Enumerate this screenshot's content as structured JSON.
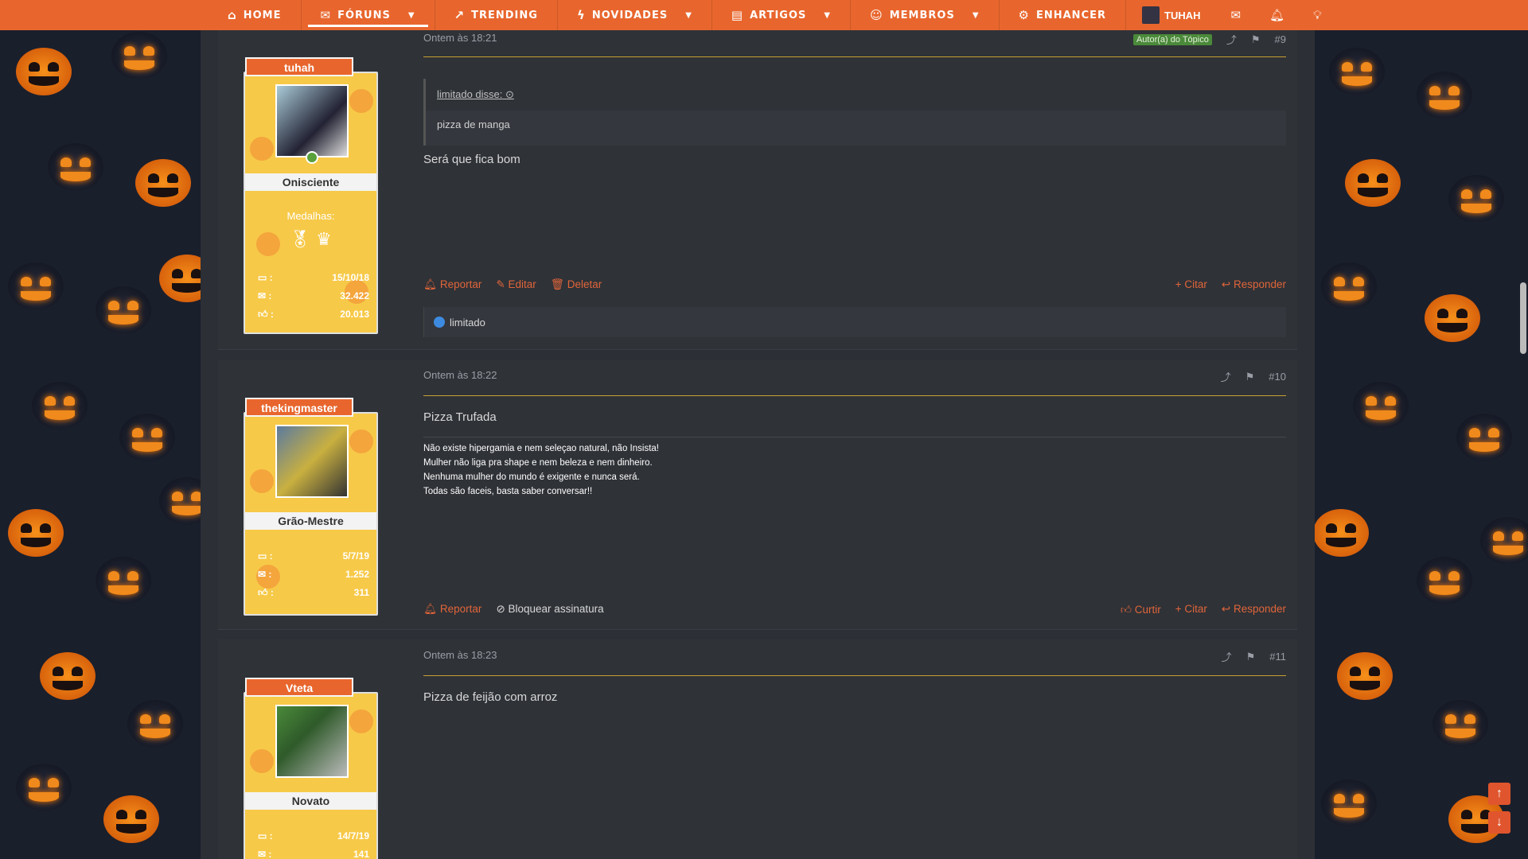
{
  "nav": {
    "items": [
      {
        "label": "HOME",
        "icon": "home-icon",
        "glyph": "⌂"
      },
      {
        "label": "FÓRUNS",
        "icon": "chat-icon",
        "glyph": "💬",
        "caret": true,
        "active": true
      },
      {
        "label": "TRENDING",
        "icon": "trending-icon",
        "glyph": "📈"
      },
      {
        "label": "NOVIDADES",
        "icon": "bolt-icon",
        "glyph": "⚡",
        "caret": true
      },
      {
        "label": "ARTIGOS",
        "icon": "document-icon",
        "glyph": "▤",
        "caret": true
      },
      {
        "label": "MEMBROS",
        "icon": "users-icon",
        "glyph": "👥",
        "caret": true
      },
      {
        "label": "ENHANCER",
        "icon": "cogs-icon",
        "glyph": "⚙"
      }
    ],
    "user": "TUHAH"
  },
  "posts": [
    {
      "username": "tuhah",
      "rank": "Onisciente",
      "medals_label": "Medalhas:",
      "date": "Ontem às 18:21",
      "badge": "Autor(a) do Tópico",
      "number": "#9",
      "quote_author": "limitado disse:",
      "quote_text": "pizza de manga",
      "message": "Será que fica bom",
      "stats": [
        "15/10/18",
        "32.422",
        "20.013"
      ],
      "actions_left": [
        "Reportar",
        "Editar",
        "Deletar"
      ],
      "actions_right": [
        "Citar",
        "Responder"
      ],
      "reaction_user": "limitado"
    },
    {
      "username": "thekingmaster",
      "rank": "Grão-Mestre",
      "date": "Ontem às 18:22",
      "number": "#10",
      "message": "Pizza Trufada",
      "signature": [
        "Não existe hipergamia e nem seleçao natural, não Insista!",
        "Mulher não liga pra shape e nem beleza e nem dinheiro.",
        "Nenhuma mulher do mundo é exigente e nunca será.",
        "Todas são faceis, basta saber conversar!!"
      ],
      "stats": [
        "5/7/19",
        "1.252",
        "311"
      ],
      "actions_left": [
        "Reportar",
        "Bloquear assinatura"
      ],
      "actions_right": [
        "Curtir",
        "Citar",
        "Responder"
      ]
    },
    {
      "username": "Vteta",
      "rank": "Novato",
      "date": "Ontem às 18:23",
      "number": "#11",
      "message": "Pizza de feijão com arroz",
      "stats": [
        "14/7/19",
        "141"
      ]
    }
  ],
  "colors": {
    "accent": "#e8662d",
    "panel": "#2f3237",
    "sidebar": "#f7c948"
  }
}
